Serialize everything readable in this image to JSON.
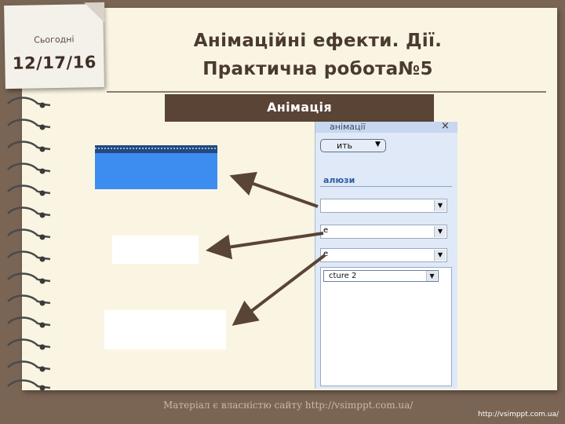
{
  "date_note": {
    "today_label": "Сьогодні",
    "date": "12/17/16"
  },
  "title": {
    "line1": "Анімаційні ефекти. Дії.",
    "line2": "Практична робота№5"
  },
  "header_bar": {
    "label": "Анімація"
  },
  "task_pane": {
    "title": "анімації",
    "close_label": "×",
    "top_combo": {
      "value": "ить",
      "arrow": "▼"
    },
    "effect_name": "алюзи",
    "start_combo": {
      "arrow": "▼"
    },
    "direction_combo": {
      "value": "е",
      "arrow": "▼"
    },
    "speed_combo": {
      "value": "е",
      "arrow": "▼"
    },
    "order_list": {
      "item": "cture 2",
      "arrow": "▼"
    }
  },
  "footer": {
    "credit": "Матеріал є власністю сайту http://vsimppt.com.ua/",
    "url": "http://vsimppt.com.ua/"
  },
  "colors": {
    "background": "#7a6555",
    "page": "#faf5e2",
    "header_bar": "#5a4436",
    "blue_box": "#3d8df0",
    "arrow": "#5a4436"
  }
}
